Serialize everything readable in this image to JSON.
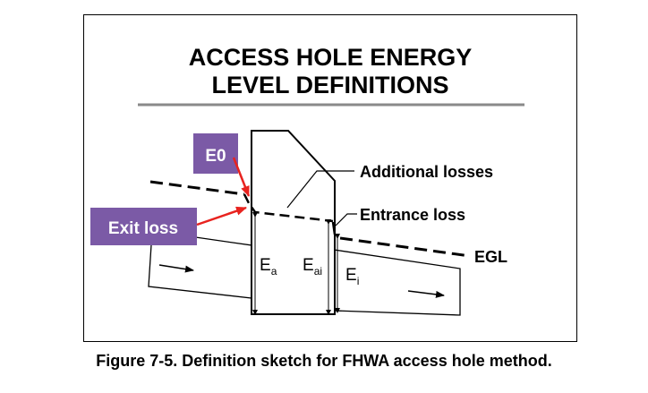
{
  "diagram": {
    "title_line1": "ACCESS HOLE ENERGY",
    "title_line2": "LEVEL DEFINITIONS",
    "labels": {
      "additional_losses": "Additional losses",
      "entrance_loss": "Entrance loss",
      "egl": "EGL",
      "e0": "E0",
      "exit_loss": "Exit loss",
      "ea": "E",
      "ea_sub": "a",
      "eai": "E",
      "eai_sub": "ai",
      "ei": "E",
      "ei_sub": "i"
    },
    "colors": {
      "callout_fill": "#7b5aa6",
      "callout_text": "#ffffff",
      "arrow": "#e8231f",
      "title_rule": "#8a8a8a"
    }
  },
  "caption": "Figure 7-5.  Definition sketch for FHWA access hole method."
}
